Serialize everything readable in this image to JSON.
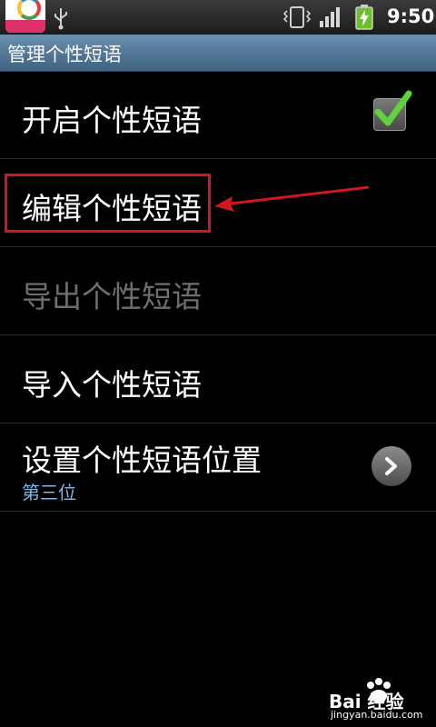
{
  "statusbar": {
    "time": "9:50",
    "icons": [
      "app-icon",
      "usb-icon",
      "vibrate-icon",
      "signal-icon",
      "battery-charging-icon"
    ]
  },
  "titlebar": {
    "title": "管理个性短语"
  },
  "list": {
    "items": [
      {
        "label": "开启个性短语",
        "checked": true
      },
      {
        "label": "编辑个性短语"
      },
      {
        "label": "导出个性短语",
        "disabled": true
      },
      {
        "label": "导入个性短语"
      },
      {
        "label": "设置个性短语位置",
        "summary": "第三位"
      }
    ]
  },
  "colors": {
    "title_bar": "#4f7394",
    "summary_text": "#7fb8e6",
    "check": "#5fd43a",
    "annotation": "#d0161f"
  },
  "watermark": {
    "brand": "Bai 经验",
    "domain": "jingyan.baidu.com"
  }
}
